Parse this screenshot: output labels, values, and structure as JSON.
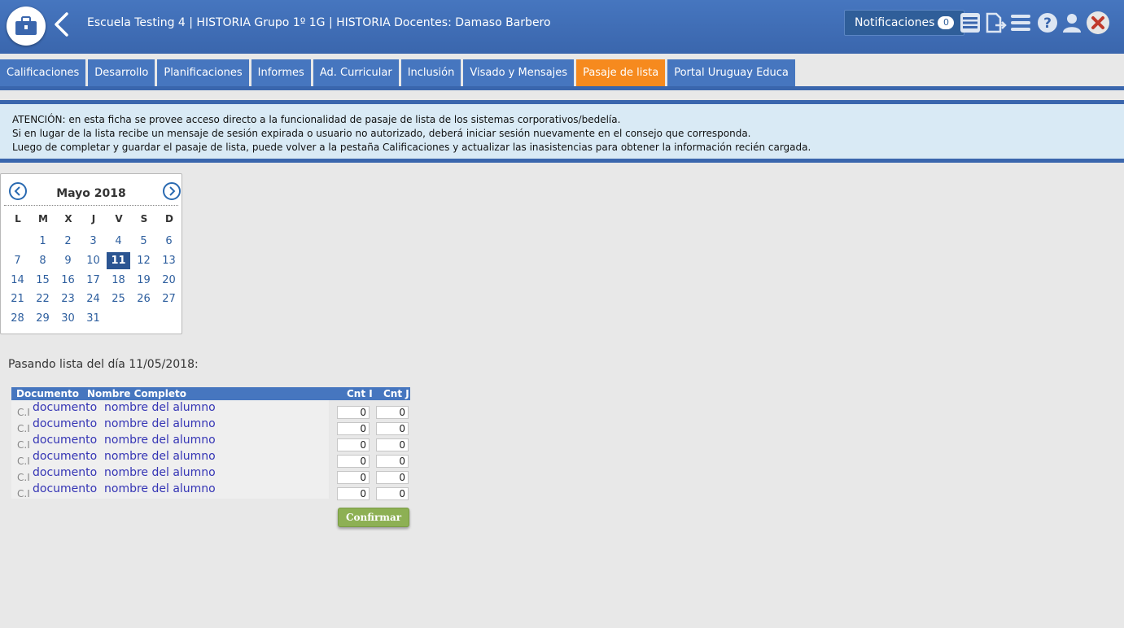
{
  "header": {
    "title": "Escuela Testing 4 | HISTORIA Grupo 1º 1G | HISTORIA Docentes: Damaso Barbero",
    "notifications_label": "Notificaciones",
    "notifications_count": "0"
  },
  "tabs": [
    {
      "label": "Calificaciones"
    },
    {
      "label": "Desarrollo"
    },
    {
      "label": "Planificaciones"
    },
    {
      "label": "Informes"
    },
    {
      "label": "Ad. Curricular"
    },
    {
      "label": "Inclusión"
    },
    {
      "label": "Visado y Mensajes"
    },
    {
      "label": "Pasaje de lista",
      "active": true
    },
    {
      "label": "Portal Uruguay Educa"
    }
  ],
  "notice": {
    "line1": "ATENCIÓN: en esta ficha se provee acceso directo a la funcionalidad de pasaje de lista de los sistemas corporativos/bedelía.",
    "line2": "Si en lugar de la lista recibe un mensaje de sesión expirada o usuario no autorizado, deberá iniciar sesión nuevamente en el consejo que corresponda.",
    "line3": "Luego de completar y guardar el pasaje de lista, puede volver a la pestaña Calificaciones y actualizar las inasistencias para obtener la información recién cargada."
  },
  "calendar": {
    "month_label": "Mayo 2018",
    "prev_icon": "chevron-left-circle-icon",
    "next_icon": "chevron-right-circle-icon",
    "weekdays": [
      "L",
      "M",
      "X",
      "J",
      "V",
      "S",
      "D"
    ],
    "first_weekday_index": 1,
    "days_in_month": 31,
    "selected_day": 11
  },
  "list": {
    "passing_text": "Pasando lista del día 11/05/2018:",
    "headers": {
      "documento": "Documento",
      "nombre": "Nombre Completo",
      "cnt_i": "Cnt I",
      "cnt_j": "Cnt J"
    },
    "rows": [
      {
        "ci": "C.I",
        "doc": "documento",
        "name": "nombre del alumno",
        "cnt_i": "0",
        "cnt_j": "0"
      },
      {
        "ci": "C.I",
        "doc": "documento",
        "name": "nombre del alumno",
        "cnt_i": "0",
        "cnt_j": "0"
      },
      {
        "ci": "C.I",
        "doc": "documento",
        "name": "nombre del alumno",
        "cnt_i": "0",
        "cnt_j": "0"
      },
      {
        "ci": "C.I",
        "doc": "documento",
        "name": "nombre del alumno",
        "cnt_i": "0",
        "cnt_j": "0"
      },
      {
        "ci": "C.I",
        "doc": "documento",
        "name": "nombre del alumno",
        "cnt_i": "0",
        "cnt_j": "0"
      },
      {
        "ci": "C.I",
        "doc": "documento",
        "name": "nombre del alumno",
        "cnt_i": "0",
        "cnt_j": "0"
      }
    ],
    "confirm_label": "Confirmar"
  },
  "colors": {
    "header_blue": "#4676bf",
    "active_tab": "#f68a1e",
    "selected_day": "#2b5592",
    "confirm_green": "#8db054"
  }
}
